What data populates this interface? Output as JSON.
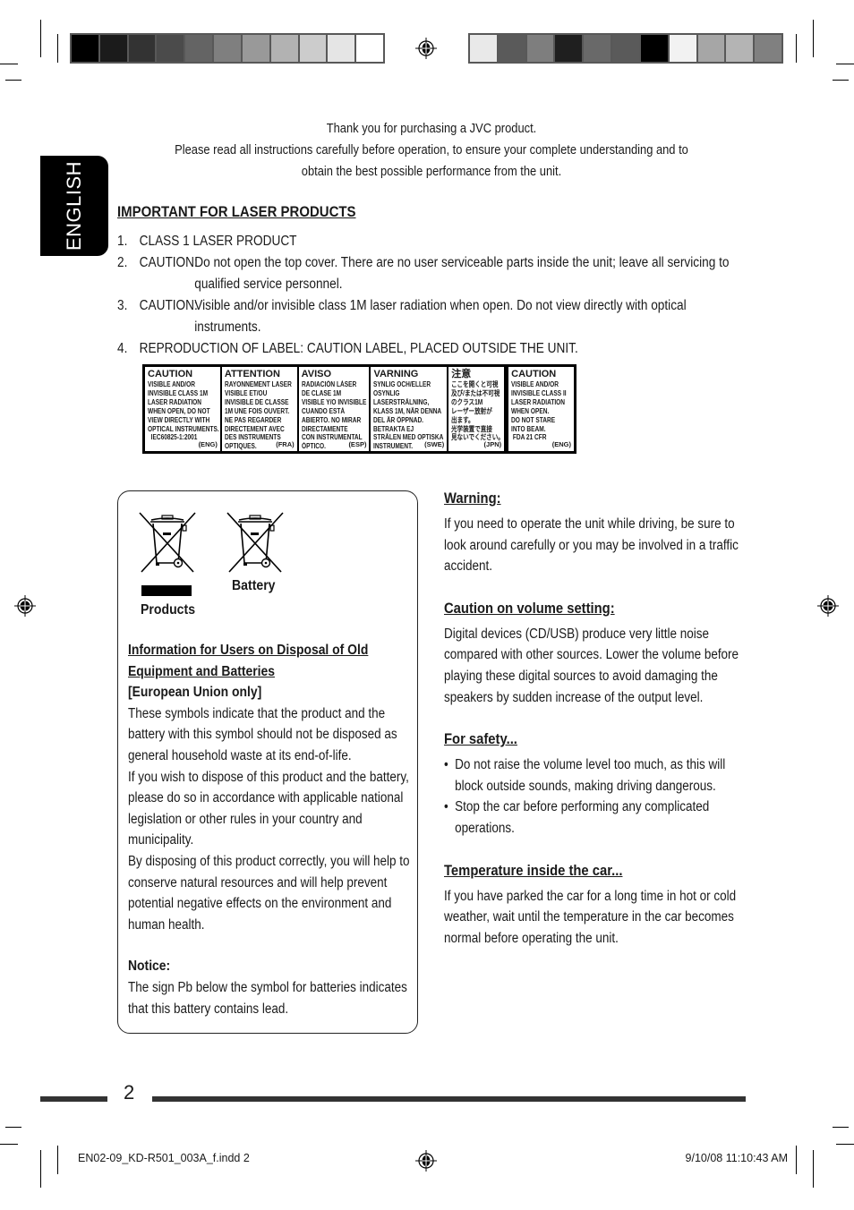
{
  "top_colorbar_left": [
    "#000000",
    "#1b1b1b",
    "#333333",
    "#4b4b4b",
    "#646464",
    "#7f7f7f",
    "#999999",
    "#b2b2b2",
    "#cccccc",
    "#e5e5e5",
    "#ffffff"
  ],
  "top_colorbar_right": [
    "#e9e9e9",
    "#5a5a5a",
    "#7e7e7e",
    "#1f1f1f",
    "#696969",
    "#5a5a5a",
    "#000000",
    "#f2f2f2",
    "#a6a6a6",
    "#b4b4b4",
    "#808080"
  ],
  "language_tab": "ENGLISH",
  "intro": {
    "line1": "Thank you for purchasing a JVC product.",
    "line2": "Please read all instructions carefully before operation, to ensure your complete understanding and to obtain the best possible performance from the unit."
  },
  "laser": {
    "title": "IMPORTANT FOR LASER PRODUCTS",
    "items": [
      {
        "num": "1.",
        "label": "",
        "text": "CLASS 1 LASER PRODUCT"
      },
      {
        "num": "2.",
        "label": "CAUTION:",
        "text": "Do not open the top cover. There are no user serviceable parts inside the unit; leave all servicing to qualified service personnel."
      },
      {
        "num": "3.",
        "label": "CAUTION:",
        "text": "Visible and/or invisible class 1M laser radiation when open. Do not view directly with optical instruments."
      },
      {
        "num": "4.",
        "label": "",
        "text": "REPRODUCTION OF LABEL: CAUTION LABEL, PLACED OUTSIDE THE UNIT."
      }
    ]
  },
  "label_cells": [
    {
      "title": "CAUTION",
      "lines": [
        "VISIBLE AND/OR",
        "INVISIBLE CLASS 1M",
        "LASER RADIATION",
        "WHEN OPEN, DO NOT",
        "VIEW DIRECTLY WITH",
        "OPTICAL INSTRUMENTS.",
        "  IEC60825-1:2001"
      ],
      "code": "(ENG)"
    },
    {
      "title": "ATTENTION",
      "lines": [
        "RAYONNEMENT LASER",
        "VISIBLE ET/OU",
        "INVISIBLE DE CLASSE",
        "1M UNE FOIS OUVERT.",
        "NE PAS REGARDER",
        "DIRECTEMENT AVEC",
        "DES INSTRUMENTS",
        "OPTIQUES."
      ],
      "code": "(FRA)"
    },
    {
      "title": "AVISO",
      "lines": [
        "RADIACIÓN LÁSER",
        "DE CLASE 1M",
        "VISIBLE Y/O INVISIBLE",
        "CUANDO ESTÁ",
        "ABIERTO. NO MIRAR",
        "DIRECTAMENTE",
        "CON INSTRUMENTAL",
        "ÓPTICO."
      ],
      "code": "(ESP)"
    },
    {
      "title": "VARNING",
      "lines": [
        "SYNLIG OCH/ELLER",
        "OSYNLIG",
        "LASERSTRÅLNING,",
        "KLASS 1M, NÄR DENNA",
        "DEL ÄR ÖPPNAD.",
        "BETRAKTA EJ",
        "STRÅLEN MED OPTISKA",
        "INSTRUMENT."
      ],
      "code": "(SWE)"
    },
    {
      "title": "注意",
      "lines": [
        "ここを開くと可視",
        "及び/または不可視",
        "のクラス1M",
        "レーザー放射が",
        "出ます。",
        "光学装置で直接",
        "見ないでください。"
      ],
      "code": "(JPN)"
    },
    {
      "title": "CAUTION",
      "lines": [
        "VISIBLE AND/OR",
        "INVISIBLE CLASS II",
        "LASER RADIATION",
        "WHEN OPEN.",
        "DO NOT STARE",
        "INTO BEAM.",
        " FDA 21 CFR"
      ],
      "code": "(ENG)"
    }
  ],
  "disposal": {
    "products_label": "Products",
    "battery_label": "Battery",
    "title_line1": "Information for Users on Disposal of Old",
    "title_line2": "Equipment and Batteries",
    "subtitle": "[European Union only]",
    "para1": "These symbols indicate that the product and the battery with this symbol should not be disposed as general household waste at its end-of-life.",
    "para2": "If you wish to dispose of this product and the battery, please do so in accordance with applicable national legislation or other rules in your country and municipality.",
    "para3": "By disposing of this product correctly, you will help to conserve natural resources and will help prevent potential negative effects on the environment and human health.",
    "notice_title": "Notice:",
    "notice_text": "The sign Pb below the symbol for batteries indicates that this battery contains lead."
  },
  "right": {
    "warning_title": "Warning:",
    "warning_text": "If you need to operate the unit while driving, be sure to look around carefully or you may be involved in a traffic accident.",
    "volume_title": "Caution on volume setting:",
    "volume_text": "Digital devices (CD/USB) produce very little noise compared with other sources. Lower the volume before playing these digital sources to avoid damaging the speakers by sudden increase of the output level.",
    "safety_title": "For safety...",
    "safety_bullets": [
      "Do not raise the volume level too much, as this will block outside sounds, making driving dangerous.",
      "Stop the car before performing any complicated operations."
    ],
    "temp_title": "Temperature inside the car...",
    "temp_text": "If you have parked the car for a long time in hot or cold weather, wait until the temperature in the car becomes normal before operating the unit."
  },
  "footer": {
    "page_number": "2",
    "slug_file": "EN02-09_KD-R501_003A_f.indd   2",
    "slug_date": "9/10/08   11:10:43 AM"
  }
}
